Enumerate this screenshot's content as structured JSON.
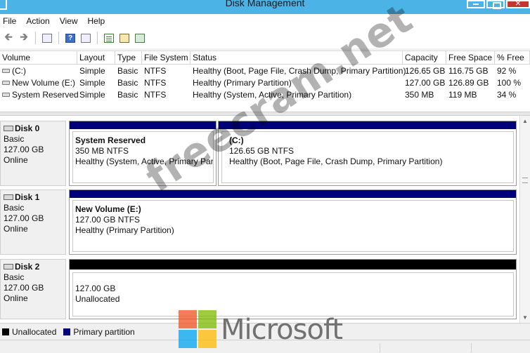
{
  "window": {
    "title": "Disk Management"
  },
  "menu": [
    "File",
    "Action",
    "View",
    "Help"
  ],
  "toolbar": {
    "buttons": [
      "back-icon",
      "forward-icon",
      "console-tree-icon",
      "help-icon",
      "show-hide-icon",
      "refresh-icon",
      "properties-icon",
      "settings-icon"
    ]
  },
  "volume_table": {
    "headers": [
      "Volume",
      "Layout",
      "Type",
      "File System",
      "Status",
      "Capacity",
      "Free Space",
      "% Free"
    ],
    "rows": [
      {
        "volume": "(C:)",
        "layout": "Simple",
        "type": "Basic",
        "fs": "NTFS",
        "status": "Healthy (Boot, Page File, Crash Dump, Primary Partition)",
        "capacity": "126.65 GB",
        "free": "116.75 GB",
        "pct": "92 %"
      },
      {
        "volume": "New Volume (E:)",
        "layout": "Simple",
        "type": "Basic",
        "fs": "NTFS",
        "status": "Healthy (Primary Partition)",
        "capacity": "127.00 GB",
        "free": "126.89 GB",
        "pct": "100 %"
      },
      {
        "volume": "System Reserved",
        "layout": "Simple",
        "type": "Basic",
        "fs": "NTFS",
        "status": "Healthy (System, Active, Primary Partition)",
        "capacity": "350 MB",
        "free": "119 MB",
        "pct": "34 %"
      }
    ]
  },
  "disks": [
    {
      "name": "Disk 0",
      "type": "Basic",
      "size": "127.00 GB",
      "state": "Online",
      "partitions": [
        {
          "name": "System Reserved",
          "size": "350 MB NTFS",
          "status": "Healthy (System, Active, Primary Partiti",
          "kind": "primary"
        },
        {
          "name": "(C:)",
          "size": "126.65 GB NTFS",
          "status": "Healthy (Boot, Page File, Crash Dump, Primary Partition)",
          "kind": "primary"
        }
      ]
    },
    {
      "name": "Disk 1",
      "type": "Basic",
      "size": "127.00 GB",
      "state": "Online",
      "partitions": [
        {
          "name": "New Volume  (E:)",
          "size": "127.00 GB NTFS",
          "status": "Healthy (Primary Partition)",
          "kind": "primary"
        }
      ]
    },
    {
      "name": "Disk 2",
      "type": "Basic",
      "size": "127.00 GB",
      "state": "Online",
      "partitions": [
        {
          "name": "",
          "size": "127.00 GB",
          "status": "Unallocated",
          "kind": "unallocated"
        }
      ]
    }
  ],
  "legend": [
    {
      "label": "Unallocated",
      "color": "#000000"
    },
    {
      "label": "Primary partition",
      "color": "#00007a"
    }
  ],
  "colors": {
    "titlebar": "#4bb3e6",
    "primary": "#00007a",
    "unallocated": "#000000"
  },
  "watermark": {
    "text": "freecram.net",
    "brand": "Microsoft"
  }
}
